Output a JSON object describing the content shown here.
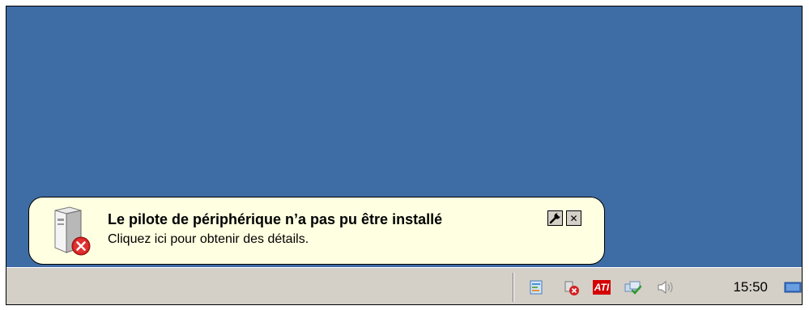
{
  "desktop": {
    "background_color": "#3e6ca4"
  },
  "notification": {
    "title": "Le pilote de périphérique n’a pas pu être installé",
    "message": "Cliquez ici pour obtenir des détails.",
    "icon": "drive-error-icon",
    "settings_icon": "wrench-icon",
    "close_icon": "close-icon",
    "background_color": "#ffffe1"
  },
  "taskbar": {
    "tray_icons": [
      "network-connections-icon",
      "device-error-icon",
      "ati-catalyst-icon",
      "network-check-icon",
      "volume-icon",
      "desktop-icon"
    ],
    "ati_label": "ATI",
    "clock": "15:50"
  }
}
